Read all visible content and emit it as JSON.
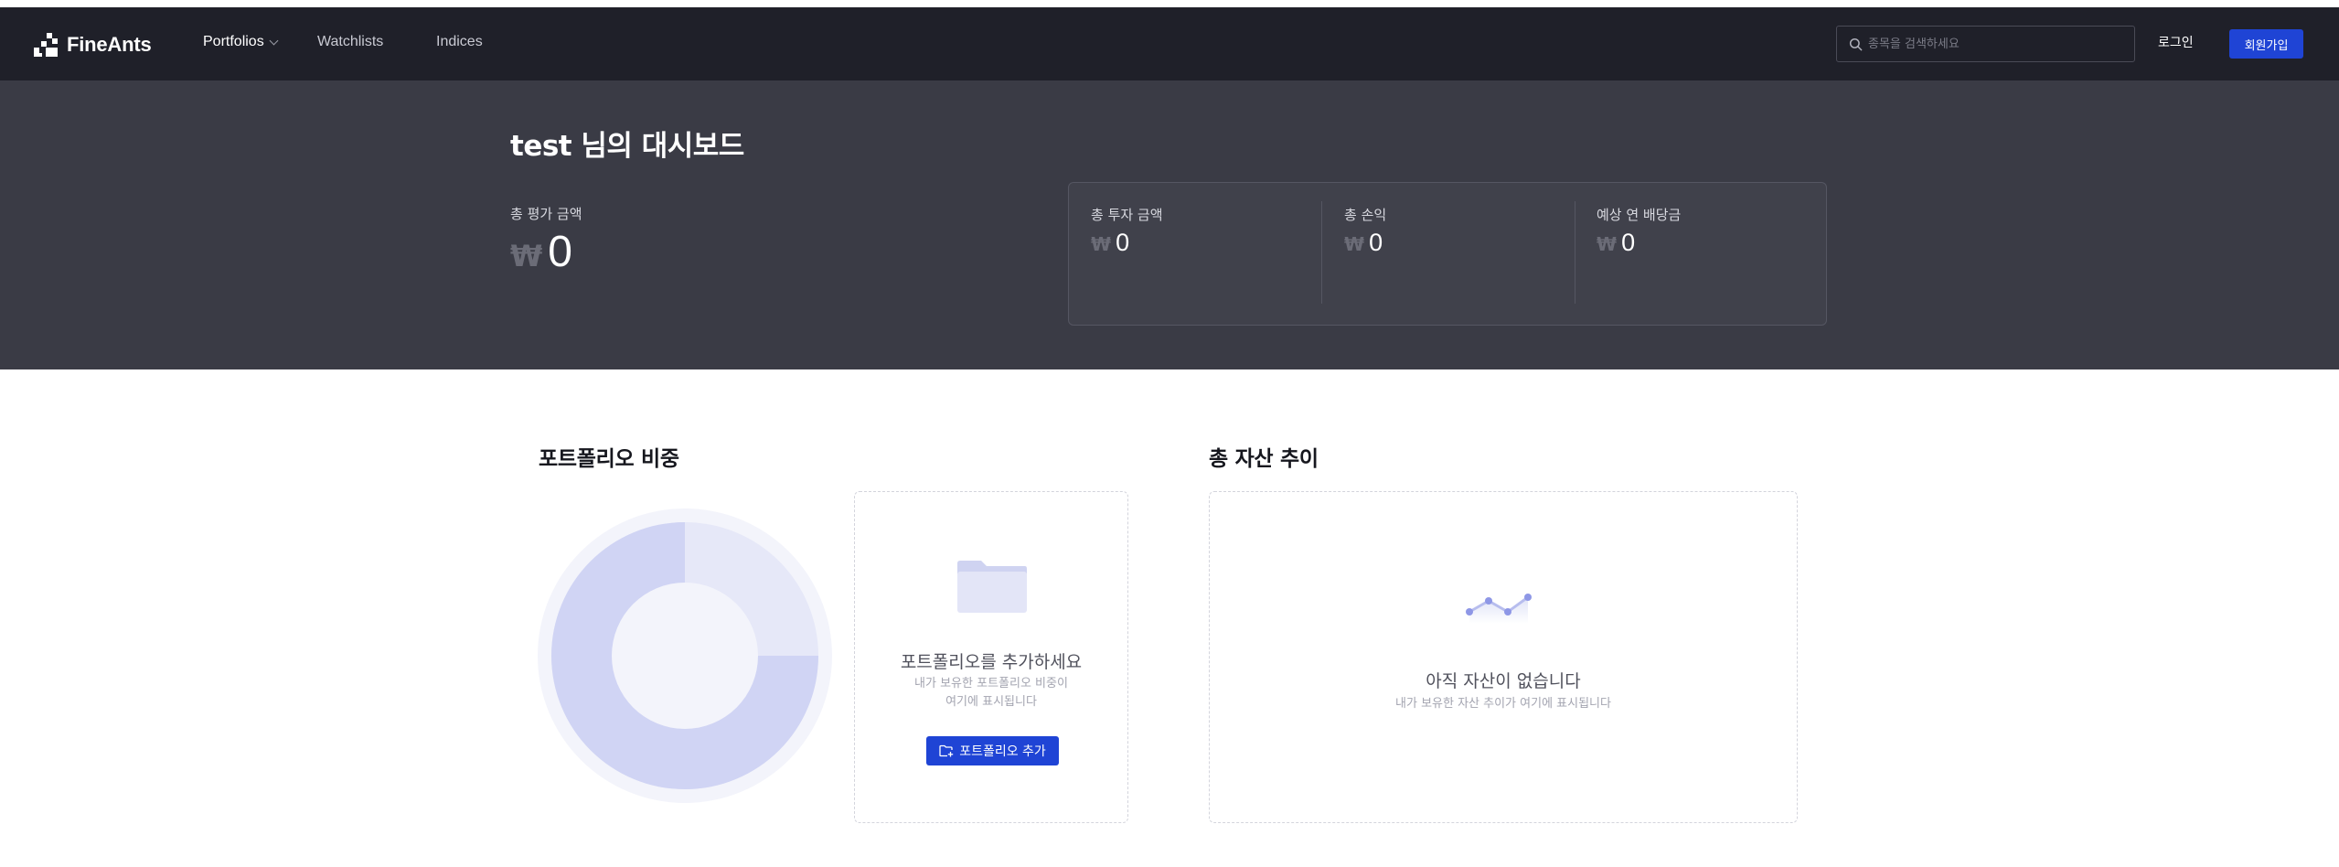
{
  "nav": {
    "brand": "FineAnts",
    "links": [
      "Portfolios",
      "Watchlists",
      "Indices"
    ],
    "search_placeholder": "종목을 검색하세요",
    "login_label": "로그인",
    "signup_label": "회원가입"
  },
  "dashboard": {
    "title": "test 님의 대시보드",
    "total_eval_label": "총 평가 금액",
    "total_eval_currency": "₩",
    "total_eval_value": "0",
    "stats": [
      {
        "label": "총 투자 금액",
        "currency": "₩",
        "value": "0"
      },
      {
        "label": "총 손익",
        "currency": "₩",
        "value": "0"
      },
      {
        "label": "예상 연 배당금",
        "currency": "₩",
        "value": "0"
      }
    ]
  },
  "portfolio_ratio": {
    "title": "포트폴리오 비중",
    "empty_title": "포트폴리오를 추가하세요",
    "empty_desc_line1": "내가 보유한 포트폴리오 비중이",
    "empty_desc_line2": "여기에 표시됩니다",
    "add_button_label": "포트폴리오 추가"
  },
  "asset_trend": {
    "title": "총 자산 추이",
    "empty_title": "아직 자산이 없습니다",
    "empty_desc": "내가 보유한 자산 추이가 여기에 표시됩니다"
  },
  "colors": {
    "nav_bg": "#1f2029",
    "hero_bg": "#3a3b45",
    "accent": "#1f44d5",
    "donut_light": "#e4e6f7",
    "donut_main": "#cfd3f3"
  },
  "icons": [
    "logo-icon",
    "chevron-down-icon",
    "search-icon",
    "folder-icon",
    "line-chart-icon",
    "folder-add-icon"
  ]
}
